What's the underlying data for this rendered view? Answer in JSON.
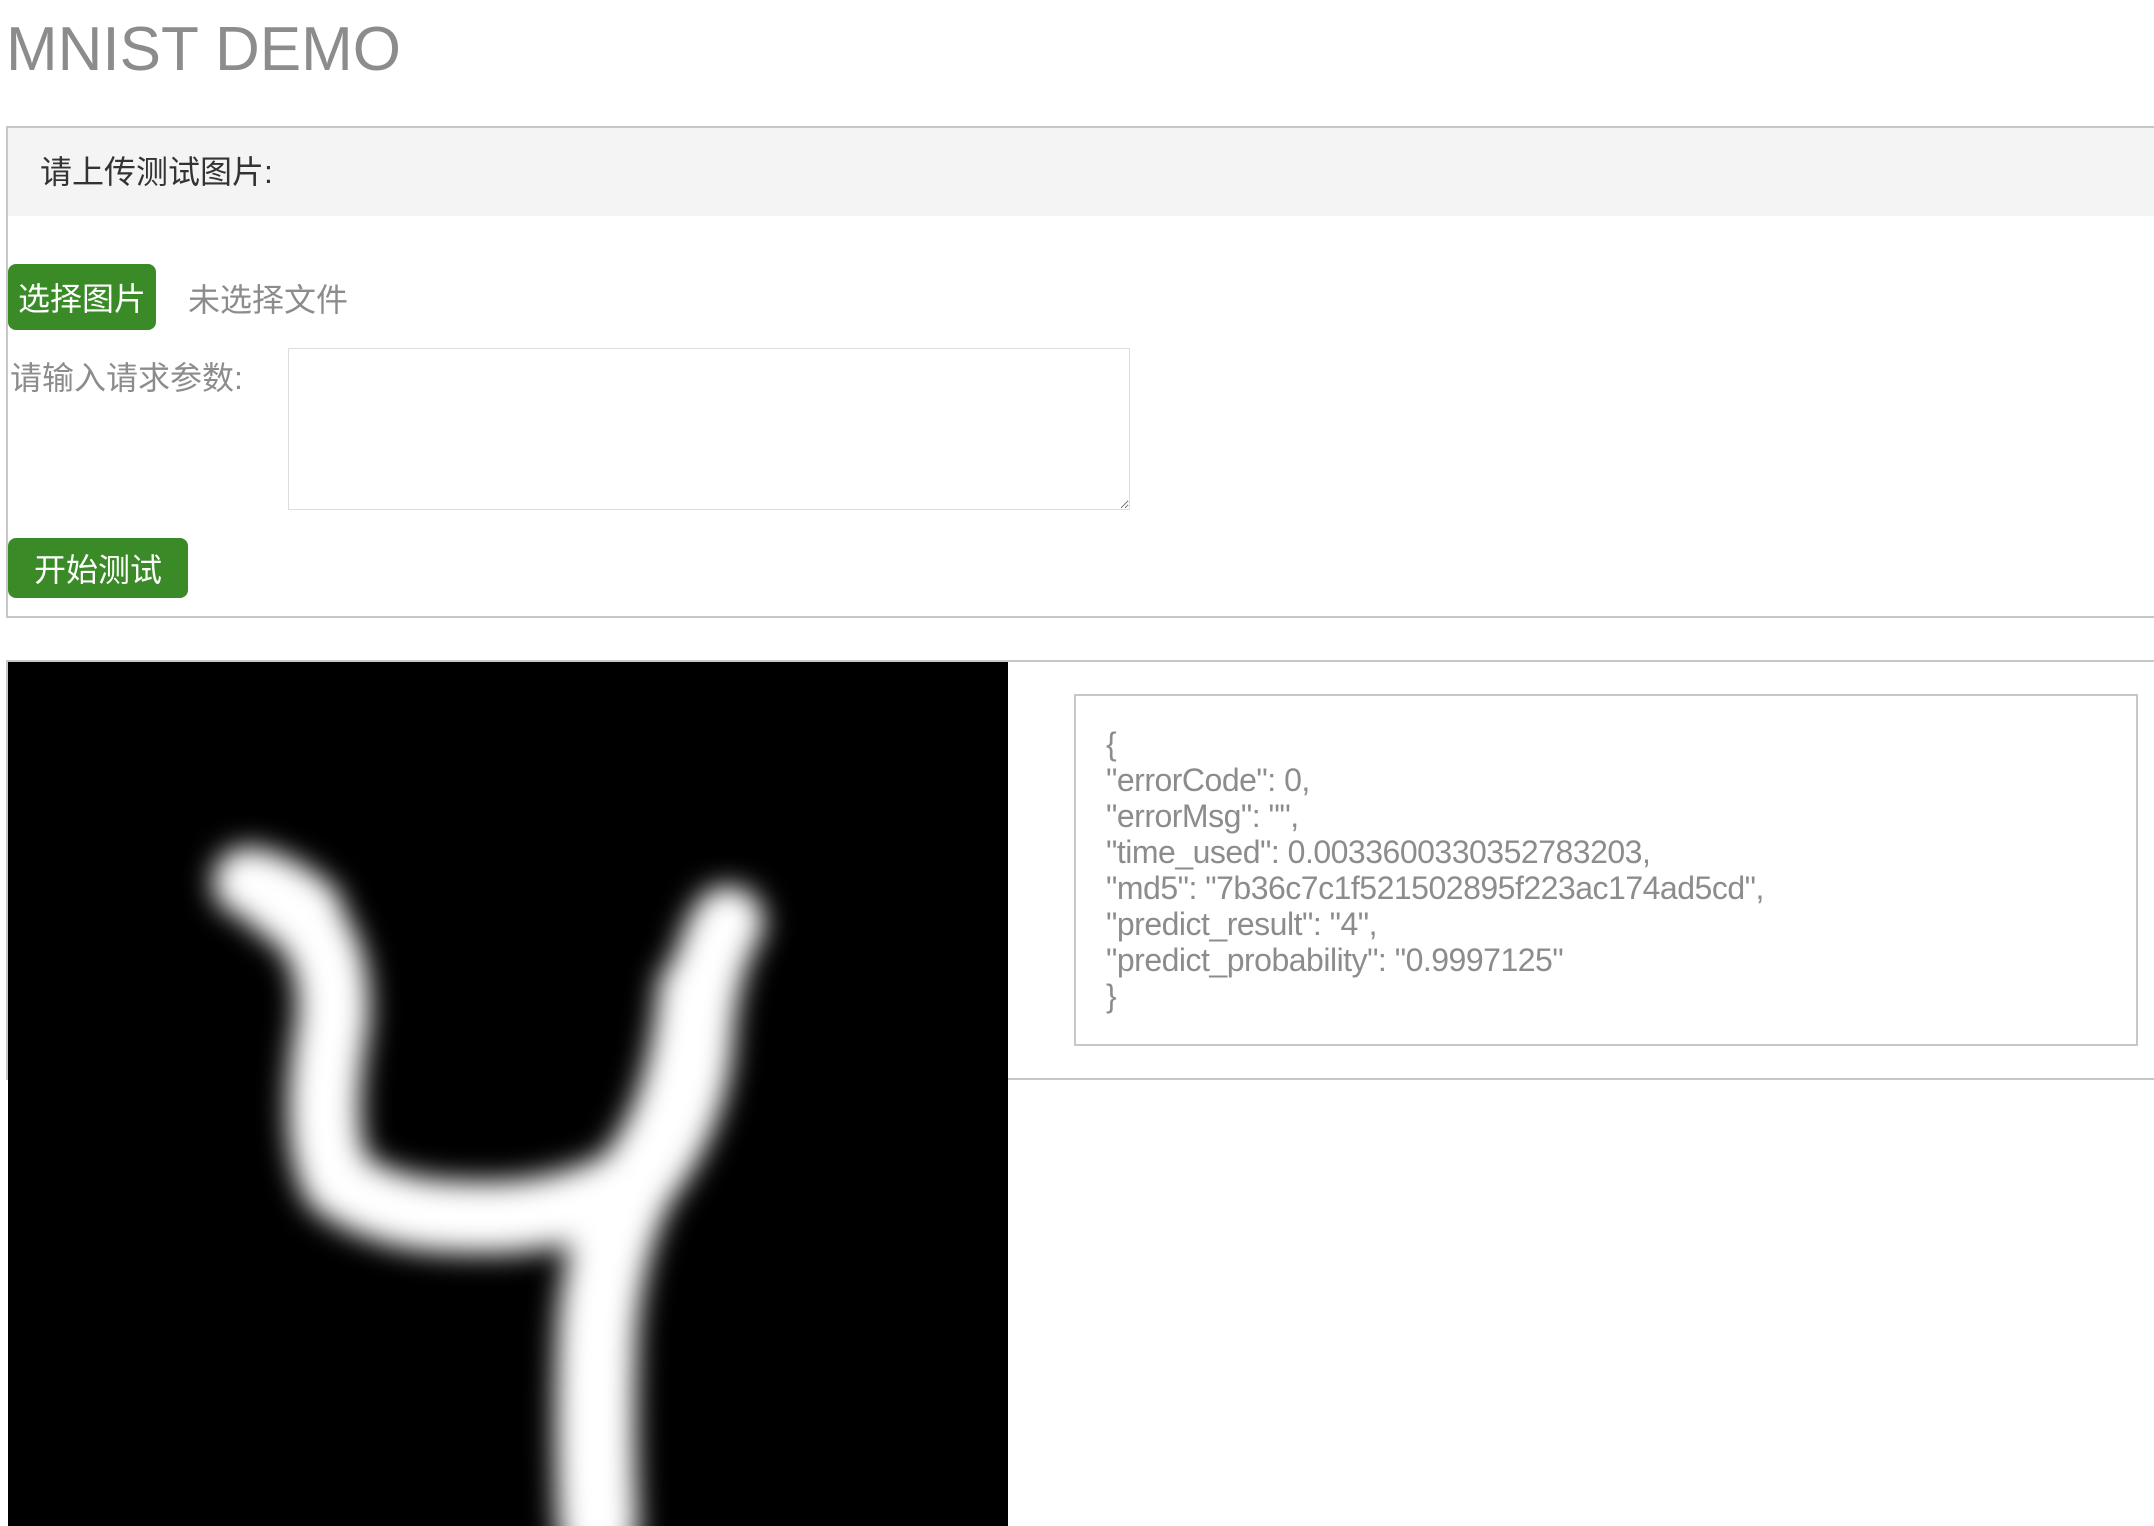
{
  "page": {
    "title": "MNIST DEMO"
  },
  "upload_panel": {
    "header_label": "请上传测试图片:",
    "choose_button_label": "选择图片",
    "file_status": "未选择文件",
    "params_label": "请输入请求参数:",
    "params_value": "",
    "start_button_label": "开始测试"
  },
  "result": {
    "image_description_icon": "digit-4-image",
    "response_lines": [
      "{",
      "\"errorCode\": 0,",
      "\"errorMsg\": \"\",",
      "\"time_used\": 0.0033600330352783203,",
      "\"md5\": \"7b36c7c1f521502895f223ac174ad5cd\",",
      "\"predict_result\": \"4\",",
      "\"predict_probability\": \"0.9997125\"",
      "}"
    ]
  },
  "colors": {
    "button_green": "#3a8a27",
    "header_bg": "#f4f4f4",
    "muted_text": "#8c8c8c",
    "border": "#c8c8c8"
  }
}
